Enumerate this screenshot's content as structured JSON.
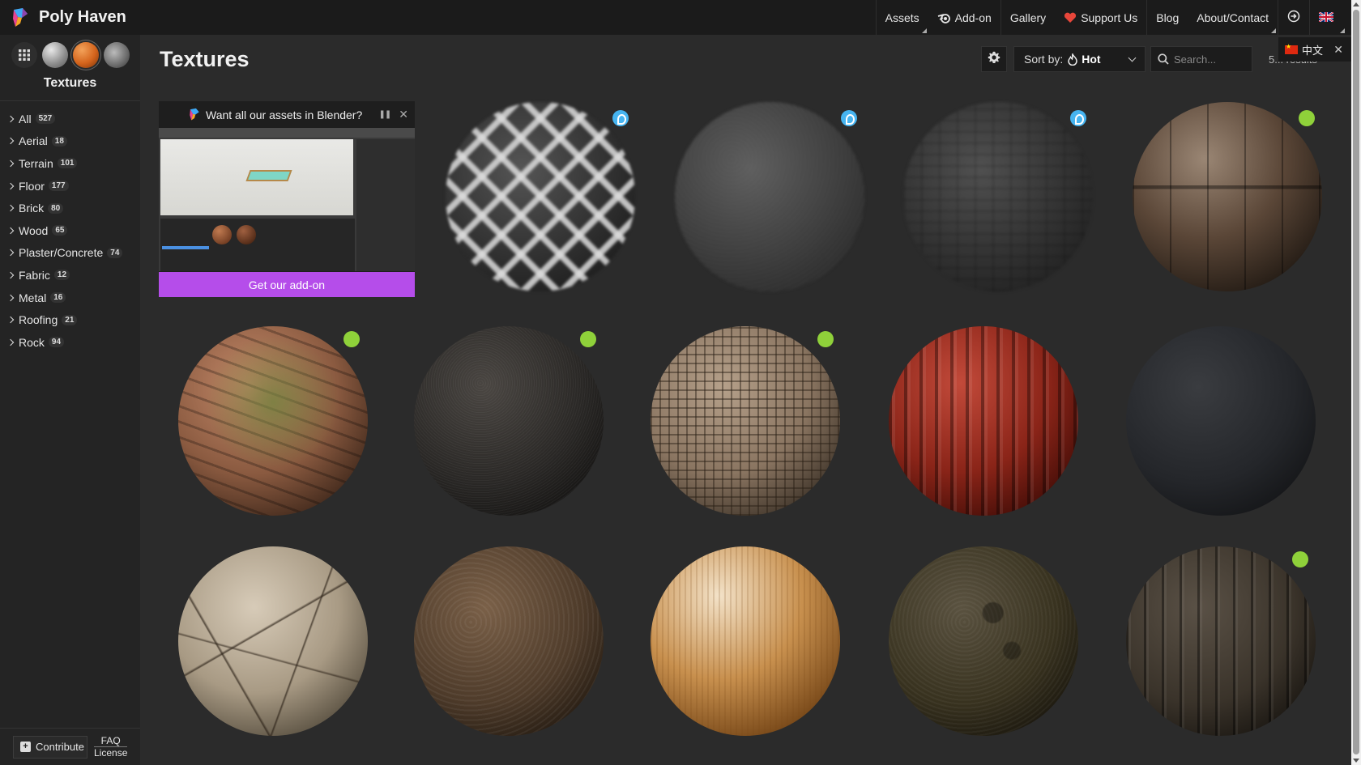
{
  "app": {
    "name": "Poly Haven"
  },
  "nav": {
    "assets": "Assets",
    "addon": "Add-on",
    "gallery": "Gallery",
    "support": "Support Us",
    "blog": "Blog",
    "about": "About/Contact"
  },
  "sidebar": {
    "title": "Textures",
    "categories": [
      {
        "label": "All",
        "count": "527"
      },
      {
        "label": "Aerial",
        "count": "18"
      },
      {
        "label": "Terrain",
        "count": "101"
      },
      {
        "label": "Floor",
        "count": "177"
      },
      {
        "label": "Brick",
        "count": "80"
      },
      {
        "label": "Wood",
        "count": "65"
      },
      {
        "label": "Plaster/Concrete",
        "count": "74"
      },
      {
        "label": "Fabric",
        "count": "12"
      },
      {
        "label": "Metal",
        "count": "16"
      },
      {
        "label": "Roofing",
        "count": "21"
      },
      {
        "label": "Rock",
        "count": "94"
      }
    ],
    "contribute": "Contribute",
    "faq": "FAQ",
    "license": "License"
  },
  "main": {
    "title": "Textures",
    "sort_label": "Sort by:",
    "sort_value": "Hot",
    "search_placeholder": "Search...",
    "results": "5... results"
  },
  "lang_popup": {
    "label": "中文"
  },
  "ad": {
    "title": "Want all our assets in Blender?",
    "cta": "Get our add-on"
  },
  "tiles": [
    {
      "badge": "blue"
    },
    {
      "badge": "blue"
    },
    {
      "badge": "blue"
    },
    {
      "badge": "green"
    },
    {
      "badge": "green"
    },
    {
      "badge": "green"
    },
    {
      "badge": "green"
    },
    {
      "badge": "none"
    },
    {
      "badge": "none"
    },
    {
      "badge": "none"
    },
    {
      "badge": "none"
    },
    {
      "badge": "none"
    },
    {
      "badge": "none"
    },
    {
      "badge": "green"
    }
  ],
  "colors": {
    "accent_purple": "#b54dea",
    "badge_blue": "#46b4f0",
    "badge_green": "#8fd13a",
    "support_heart": "#e8463a"
  }
}
